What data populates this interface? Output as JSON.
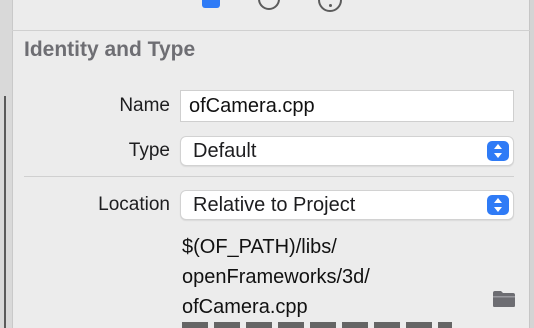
{
  "inspector": {
    "tabs": [
      {
        "icon": "file-inspector-icon",
        "active": true
      },
      {
        "icon": "history-inspector-icon",
        "active": false
      },
      {
        "icon": "quick-help-icon",
        "active": false
      }
    ],
    "accent_color": "#2f7bf6"
  },
  "identity_and_type": {
    "title": "Identity and Type",
    "name_label": "Name",
    "name_value": "ofCamera.cpp",
    "type_label": "Type",
    "type_value": "Default",
    "location_label": "Location",
    "location_value": "Relative to Project",
    "path_lines": [
      "$(OF_PATH)/libs/",
      "openFrameworks/3d/",
      "ofCamera.cpp"
    ]
  }
}
